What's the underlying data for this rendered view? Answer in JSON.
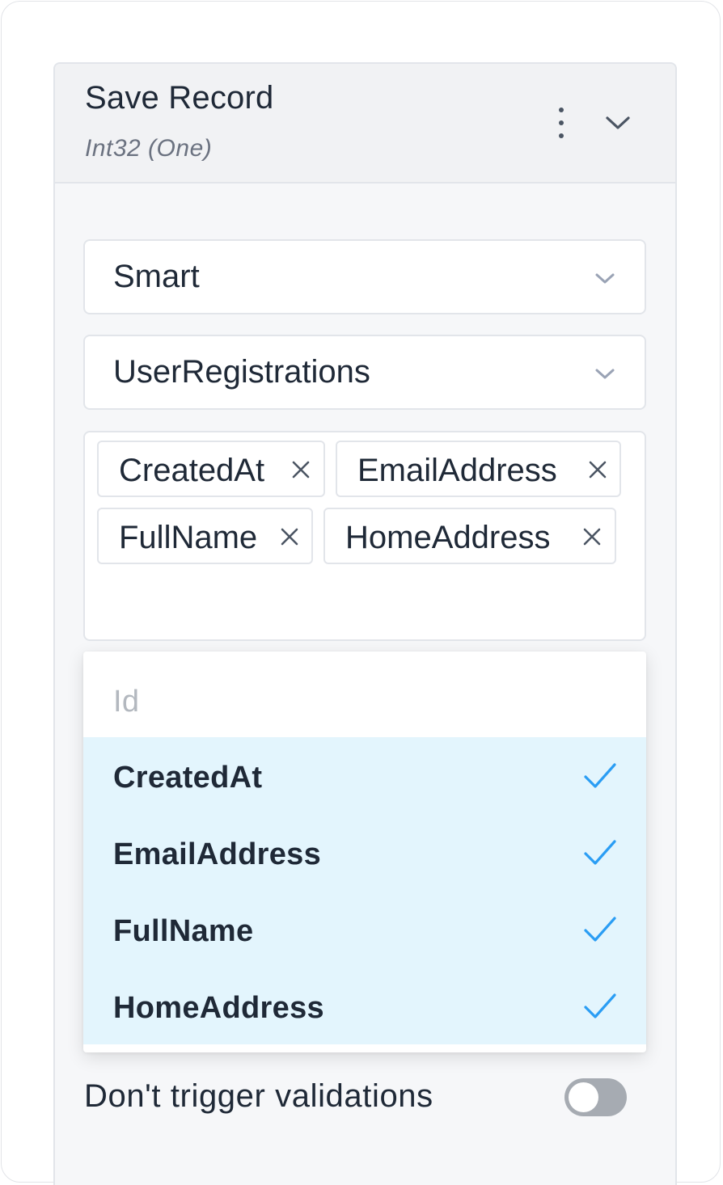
{
  "panel": {
    "title": "Save Record",
    "subtitle": "Int32 (One)",
    "menu_icon": "more-vertical-icon",
    "collapse_icon": "chevron-down-icon"
  },
  "mode_select": {
    "value": "Smart",
    "icon": "chevron-down-icon"
  },
  "table_select": {
    "value": "UserRegistrations",
    "icon": "chevron-down-icon"
  },
  "fields_select": {
    "tags": [
      "CreatedAt",
      "EmailAddress",
      "FullName",
      "HomeAddress"
    ],
    "remove_icon": "close-icon"
  },
  "dropdown": {
    "options": [
      {
        "label": "Id",
        "selected": false
      },
      {
        "label": "CreatedAt",
        "selected": true
      },
      {
        "label": "EmailAddress",
        "selected": true
      },
      {
        "label": "FullName",
        "selected": true
      },
      {
        "label": "HomeAddress",
        "selected": true
      }
    ],
    "check_icon": "checkmark-icon"
  },
  "validation_toggle": {
    "label": "Don't trigger validations",
    "checked": false
  },
  "colors": {
    "accent": "#2a9df4",
    "selected_bg": "#e3f5fd",
    "toggle_off": "#a6abb2",
    "text": "#1f2937",
    "muted": "#6b7280"
  }
}
